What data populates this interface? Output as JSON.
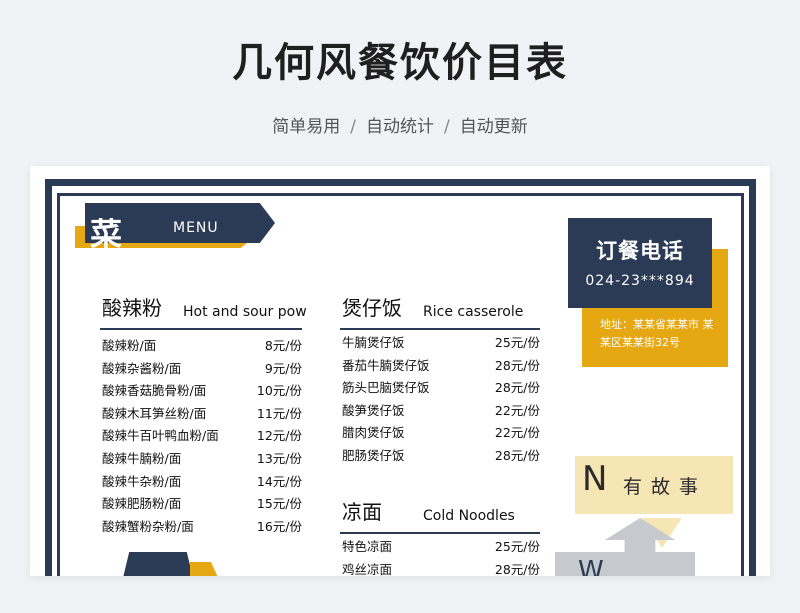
{
  "title": "几何风餐饮价目表",
  "subtitle": {
    "part1": "简单易用",
    "sep": "/",
    "part2": "自动统计",
    "part3": "自动更新"
  },
  "menu_badge": {
    "char": "菜",
    "en": "MENU"
  },
  "sections": {
    "sour_spicy": {
      "cn": "酸辣粉",
      "en": "Hot and sour pow",
      "items": [
        {
          "name": "酸辣粉/面",
          "price": "8元/份"
        },
        {
          "name": "酸辣杂酱粉/面",
          "price": "9元/份"
        },
        {
          "name": "酸辣香菇脆骨粉/面",
          "price": "10元/份"
        },
        {
          "name": "酸辣木耳笋丝粉/面",
          "price": "11元/份"
        },
        {
          "name": "酸辣牛百叶鸭血粉/面",
          "price": "12元/份"
        },
        {
          "name": "酸辣牛腩粉/面",
          "price": "13元/份"
        },
        {
          "name": "酸辣牛杂粉/面",
          "price": "14元/份"
        },
        {
          "name": "酸辣肥肠粉/面",
          "price": "15元/份"
        },
        {
          "name": "酸辣蟹粉杂粉/面",
          "price": "16元/份"
        }
      ]
    },
    "casserole": {
      "cn": "煲仔饭",
      "en": "Rice casserole",
      "items": [
        {
          "name": "牛腩煲仔饭",
          "price": "25元/份"
        },
        {
          "name": "番茄牛腩煲仔饭",
          "price": "28元/份"
        },
        {
          "name": "筋头巴脑煲仔饭",
          "price": "28元/份"
        },
        {
          "name": "酸笋煲仔饭",
          "price": "22元/份"
        },
        {
          "name": "腊肉煲仔饭",
          "price": "22元/份"
        },
        {
          "name": "肥肠煲仔饭",
          "price": "28元/份"
        }
      ]
    },
    "cold_noodles": {
      "cn": "凉面",
      "en": "Cold Noodles",
      "items": [
        {
          "name": "特色凉面",
          "price": "25元/份"
        },
        {
          "name": "鸡丝凉面",
          "price": "28元/份"
        }
      ]
    }
  },
  "order": {
    "title": "订餐电话",
    "phone": "024-23***894",
    "address": "地址：某某省某某市 某某区某某街32号"
  },
  "story": {
    "letter": "N",
    "text": "有故事",
    "bottom_letter": "W"
  },
  "colors": {
    "navy": "#2b3a55",
    "yellow": "#e5a712",
    "cream": "#f6e6b6",
    "gray": "#c6c9ce"
  }
}
